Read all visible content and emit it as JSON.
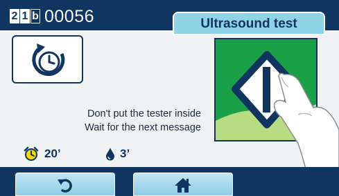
{
  "header": {
    "program_digits": [
      "2",
      "1",
      "b"
    ],
    "cycle_number": "00056",
    "title": "Ultrasound test"
  },
  "message": {
    "line1": "Don't put the tester inside",
    "line2": "Wait for the next message"
  },
  "readouts": {
    "timer": "20’",
    "water": "3’"
  },
  "icons": {
    "cycle": "cycle-clock-icon",
    "timer": "alarm-clock-icon",
    "water": "water-drop-icon",
    "test": "ultrasound-tester-icon",
    "back": "back-arrow-icon",
    "home": "home-icon"
  },
  "colors": {
    "primary_navy": "#0f3560",
    "title_tab": "#8fd4e6",
    "panel_green": "#1aa046",
    "alarm_yellow": "#f5d800"
  }
}
